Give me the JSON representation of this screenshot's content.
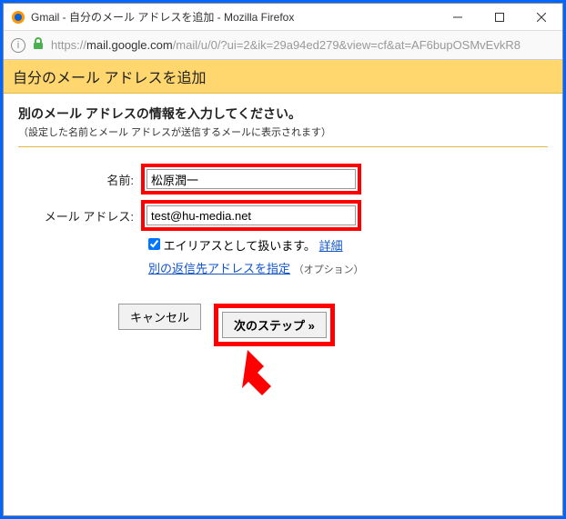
{
  "window": {
    "title": "Gmail - 自分のメール アドレスを追加 - Mozilla Firefox"
  },
  "addressbar": {
    "scheme": "https://",
    "host": "mail.google.com",
    "path": "/mail/u/0/?ui=2&ik=29a94ed279&view=cf&at=AF6bupOSMvEvkR8"
  },
  "header": {
    "title": "自分のメール アドレスを追加"
  },
  "page": {
    "lead": "別のメール アドレスの情報を入力してください。",
    "sub": "（設定した名前とメール アドレスが送信するメールに表示されます）"
  },
  "form": {
    "name_label": "名前:",
    "name_value": "松原潤一",
    "email_label": "メール アドレス:",
    "email_value": "test@hu-media.net",
    "alias_label": "エイリアスとして扱います。",
    "alias_detail": "詳細",
    "reply_link": "別の返信先アドレスを指定",
    "reply_suffix": "（オプション）"
  },
  "actions": {
    "cancel": "キャンセル",
    "next": "次のステップ »"
  }
}
